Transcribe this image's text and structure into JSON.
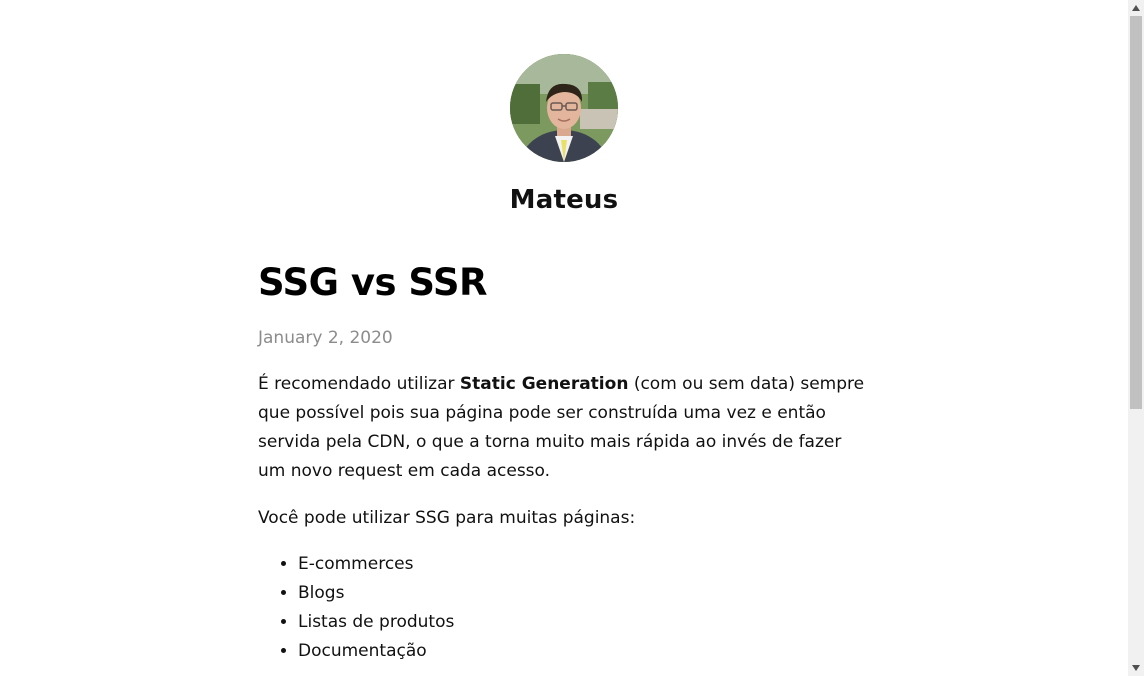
{
  "header": {
    "site_name": "Mateus"
  },
  "post": {
    "title": "SSG vs SSR",
    "date": "January 2, 2020",
    "intro_before": "É recomendado utilizar ",
    "intro_bold": "Static Generation",
    "intro_after": " (com ou sem data) sempre que possível pois sua página pode ser construída uma vez e então servida pela CDN, o que a torna muito mais rápida ao invés de fazer um novo request em cada acesso.",
    "paragraph_2": "Você pode utilizar SSG para muitas páginas:",
    "list_items": [
      "E-commerces",
      "Blogs",
      "Listas de produtos",
      "Documentação"
    ]
  },
  "icons": {
    "scroll_up": "triangle-up-icon",
    "scroll_down": "triangle-down-icon"
  },
  "colors": {
    "text": "#111111",
    "date": "#8c8c8c",
    "scrollbar_track": "#f1f1f1",
    "scrollbar_thumb": "#c1c1c1"
  }
}
